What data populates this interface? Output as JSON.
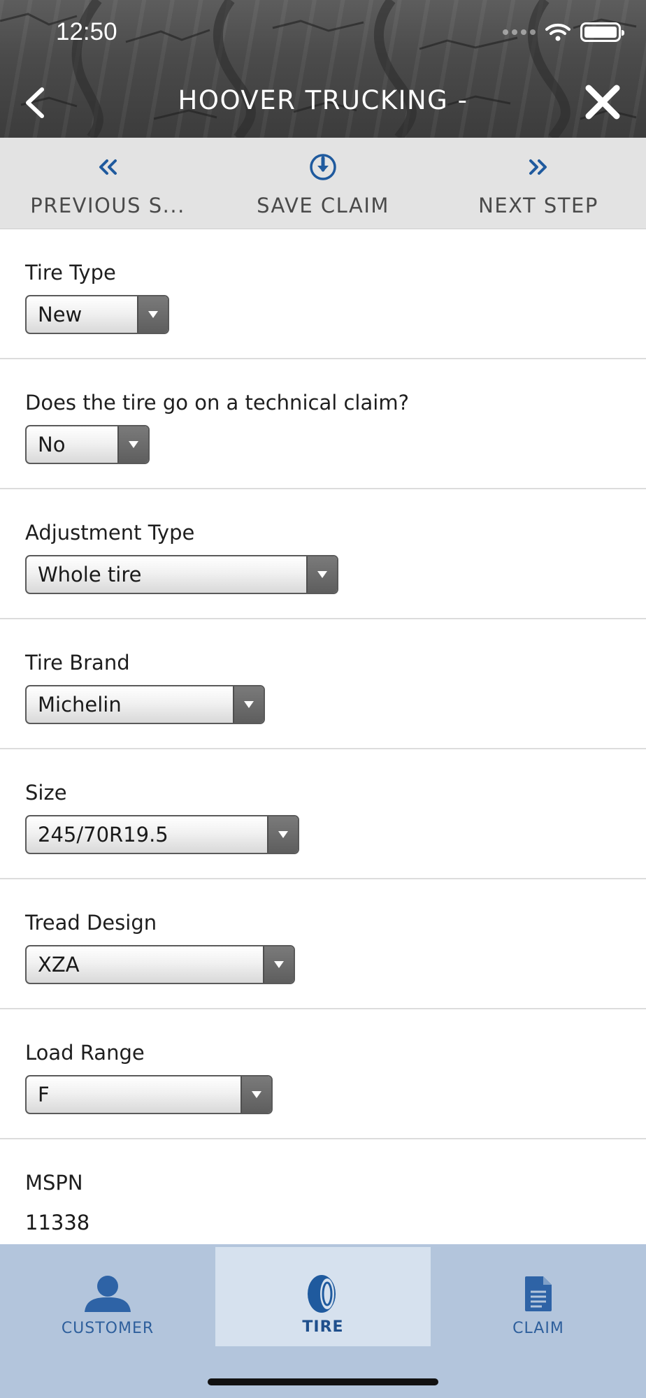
{
  "status_bar": {
    "time": "12:50"
  },
  "header": {
    "title": "HOOVER TRUCKING -"
  },
  "toolbar": {
    "previous_label": "PREVIOUS S...",
    "save_label": "SAVE CLAIM",
    "next_label": "NEXT STEP"
  },
  "fields": {
    "tire_type": {
      "label": "Tire Type",
      "value": "New"
    },
    "technical_claim": {
      "label": "Does the tire go on a technical claim?",
      "value": "No"
    },
    "adjustment_type": {
      "label": "Adjustment Type",
      "value": "Whole tire"
    },
    "tire_brand": {
      "label": "Tire Brand",
      "value": "Michelin"
    },
    "size": {
      "label": "Size",
      "value": "245/70R19.5"
    },
    "tread_design": {
      "label": "Tread Design",
      "value": "XZA"
    },
    "load_range": {
      "label": "Load Range",
      "value": "F"
    },
    "mspn": {
      "label": "MSPN",
      "value": "11338"
    }
  },
  "tabs": {
    "customer": {
      "label": "CUSTOMER"
    },
    "tire": {
      "label": "TIRE",
      "active": true
    },
    "claim": {
      "label": "CLAIM"
    }
  },
  "colors": {
    "accent_blue": "#1f5a9e",
    "tabbar_bg": "#b3c5dc",
    "tab_active_bg": "#d6e1ee",
    "toolbar_bg": "#e3e3e3"
  },
  "icons": {
    "back": "chevron-left-icon",
    "close": "close-icon",
    "previous": "double-chevron-left-icon",
    "save": "download-circle-icon",
    "next": "double-chevron-right-icon",
    "customer": "person-icon",
    "tire": "tire-icon",
    "claim": "document-icon"
  }
}
